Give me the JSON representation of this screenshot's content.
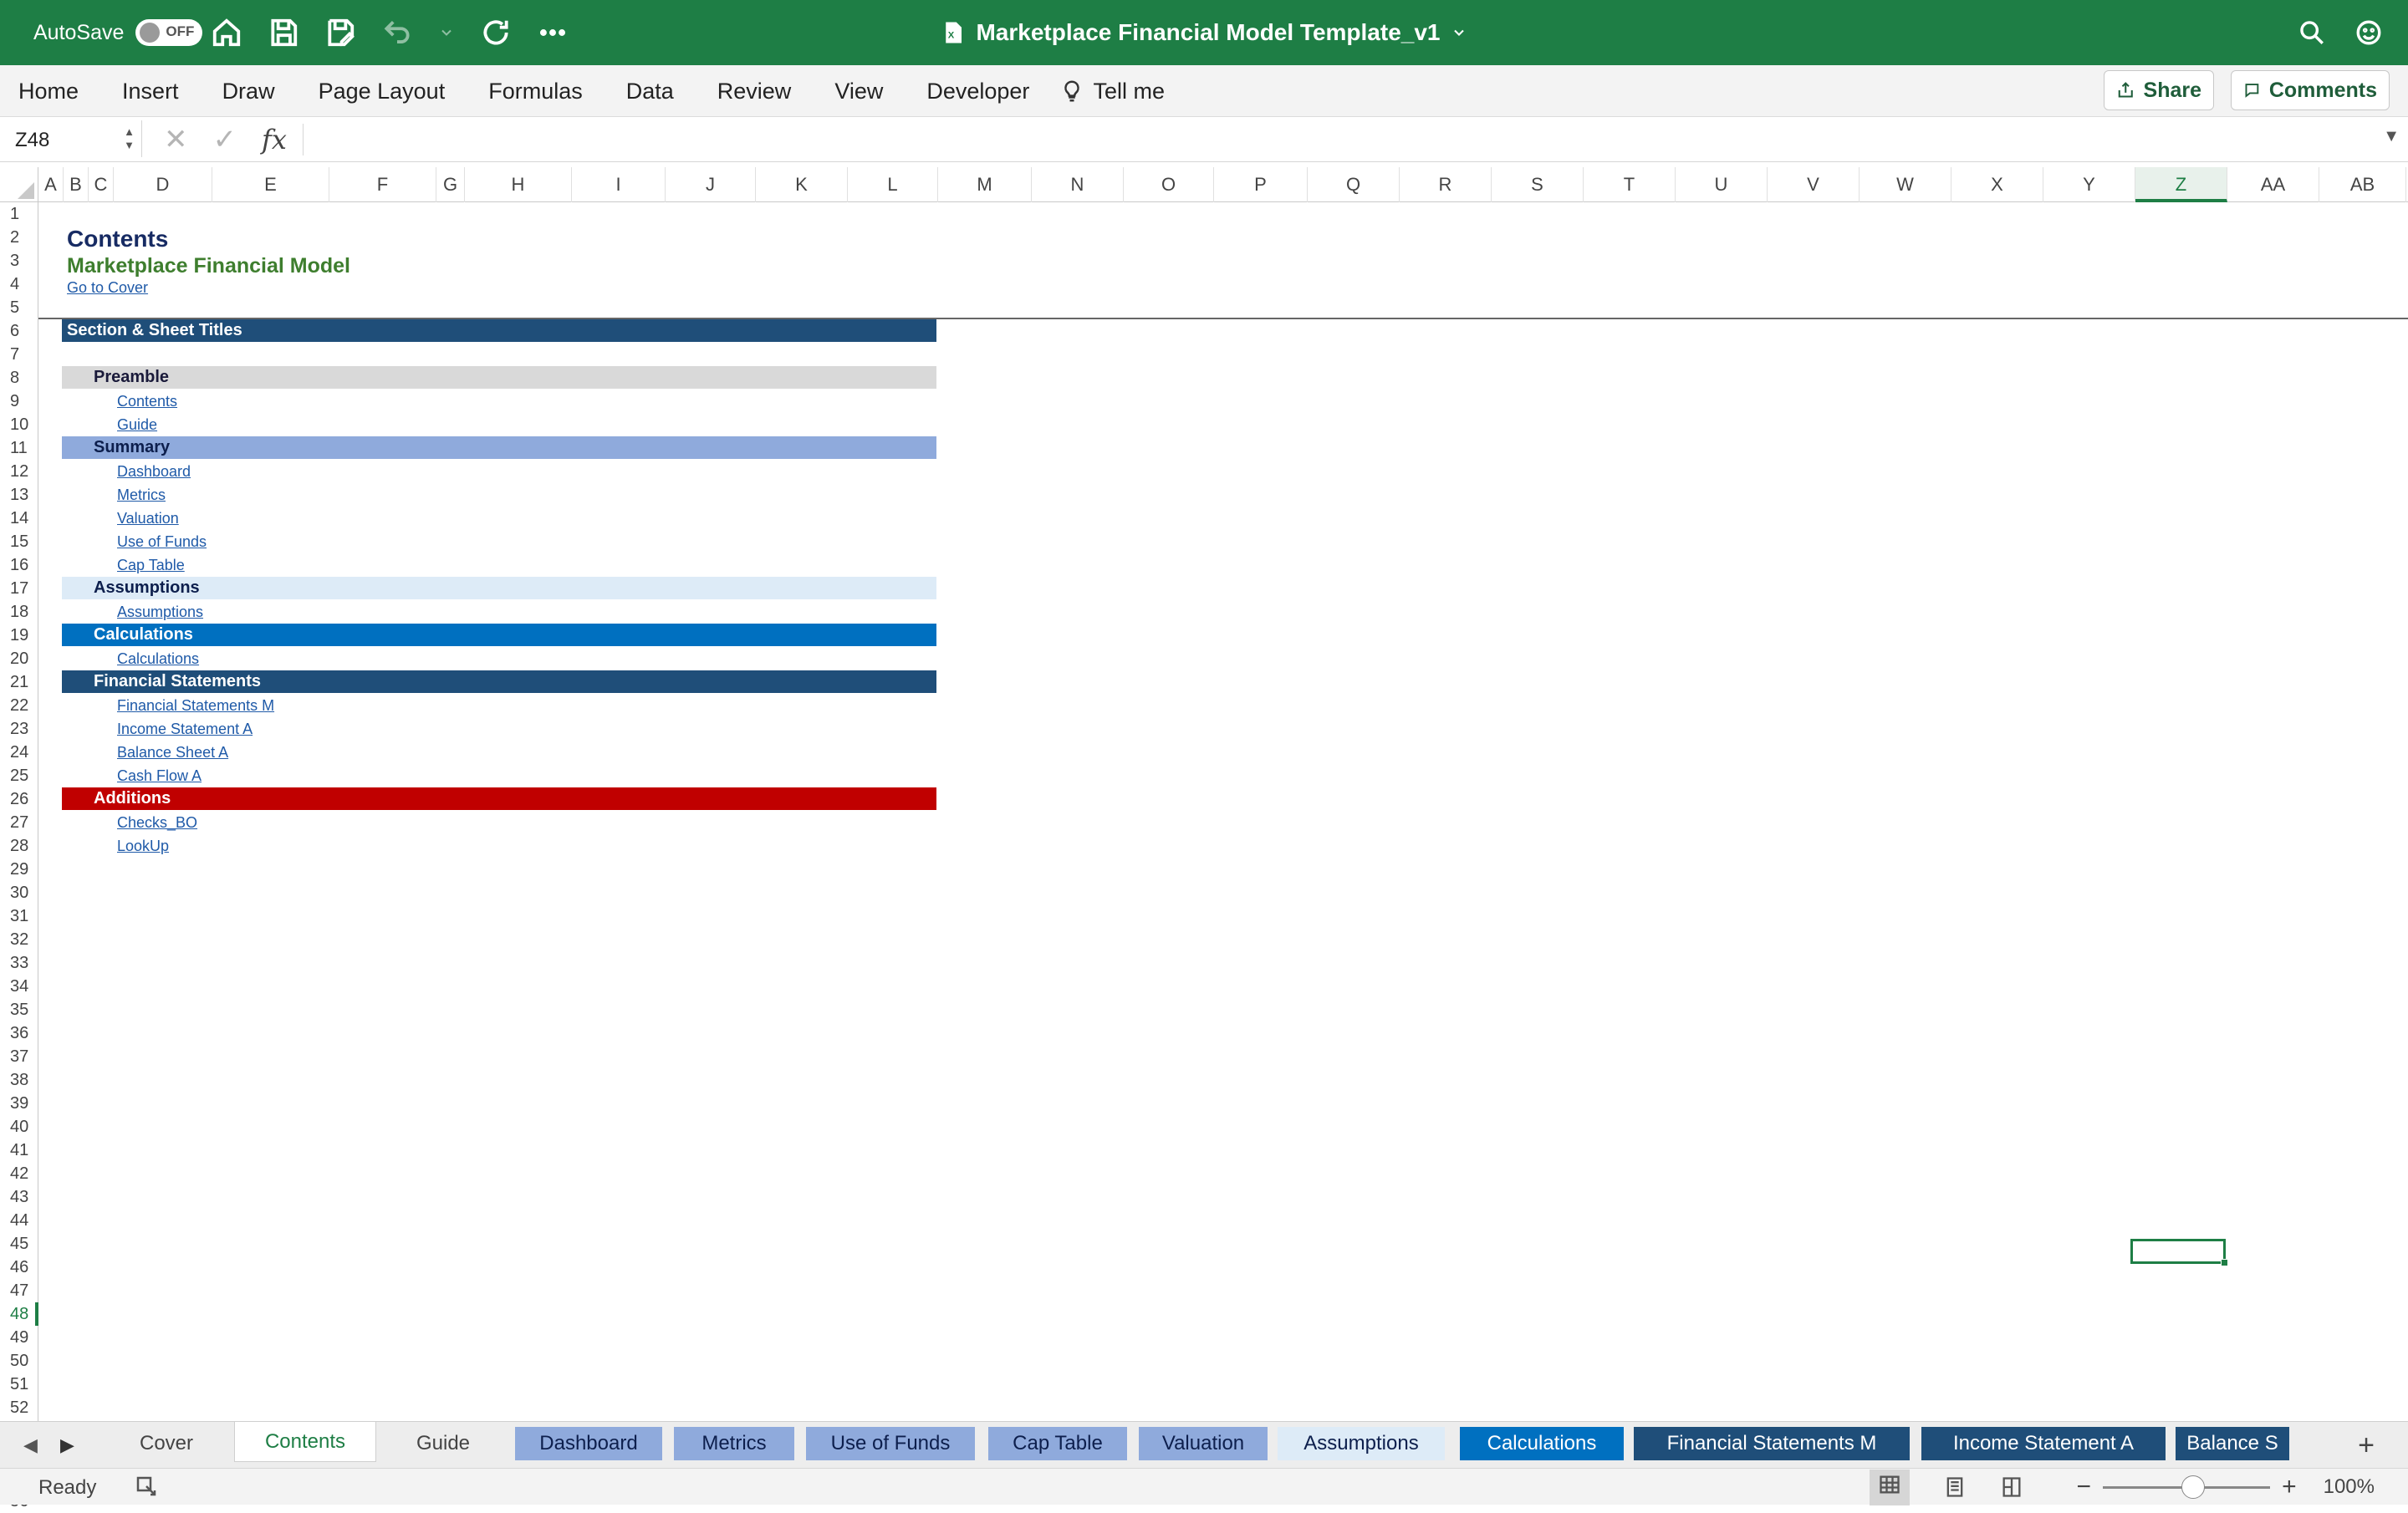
{
  "titlebar": {
    "autosave_label": "AutoSave",
    "autosave_state": "OFF",
    "doc_title": "Marketplace Financial Model Template_v1",
    "icons": [
      "home-icon",
      "save-icon",
      "save-as-icon",
      "undo-icon",
      "redo-icon",
      "more-icon"
    ],
    "right_icons": [
      "search-icon",
      "smiley-icon"
    ]
  },
  "ribbon": {
    "menu": [
      "Home",
      "Insert",
      "Draw",
      "Page Layout",
      "Formulas",
      "Data",
      "Review",
      "View",
      "Developer"
    ],
    "tell_me": "Tell me",
    "share_label": "Share",
    "comments_label": "Comments"
  },
  "formulabar": {
    "name_box": "Z48",
    "fx": "fx",
    "value": ""
  },
  "grid": {
    "columns": [
      "A",
      "B",
      "C",
      "D",
      "E",
      "F",
      "G",
      "H",
      "I",
      "J",
      "K",
      "L",
      "M",
      "N",
      "O",
      "P",
      "Q",
      "R",
      "S",
      "T",
      "U",
      "V",
      "W",
      "X",
      "Y",
      "Z",
      "AA",
      "AB"
    ],
    "selected_column": "Z",
    "selected_row": "48",
    "rows_count": 56,
    "heading": "Contents",
    "subheading": "Marketplace Financial Model",
    "go_to_cover": "Go to Cover",
    "table_header": "Section & Sheet Titles",
    "sections": [
      {
        "title": "Preamble",
        "color": "#d9d9d9",
        "text": "#1a1a3a",
        "links": [
          "Contents",
          "Guide"
        ]
      },
      {
        "title": "Summary",
        "color": "#8faadc",
        "text": "#0d1f4d",
        "links": [
          "Dashboard",
          "Metrics",
          "Valuation",
          "Use of Funds",
          "Cap Table"
        ]
      },
      {
        "title": "Assumptions",
        "color": "#ddebf7",
        "text": "#0d1f4d",
        "links": [
          "Assumptions"
        ]
      },
      {
        "title": "Calculations",
        "color": "#0070c0",
        "text": "#ffffff",
        "links": [
          "Calculations"
        ]
      },
      {
        "title": "Financial Statements",
        "color": "#1f4e79",
        "text": "#ffffff",
        "links": [
          "Financial Statements M",
          "Income Statement A",
          "Balance Sheet A",
          "Cash Flow A"
        ]
      },
      {
        "title": "Additions",
        "color": "#c00000",
        "text": "#ffffff",
        "links": [
          "Checks_BO",
          "LookUp"
        ]
      }
    ]
  },
  "sheet_tabs": [
    {
      "label": "Cover",
      "style": "plain"
    },
    {
      "label": "Contents",
      "style": "active"
    },
    {
      "label": "Guide",
      "style": "plain"
    },
    {
      "label": "Dashboard",
      "style": "summary"
    },
    {
      "label": "Metrics",
      "style": "summary"
    },
    {
      "label": "Use of Funds",
      "style": "summary"
    },
    {
      "label": "Cap Table",
      "style": "summary"
    },
    {
      "label": "Valuation",
      "style": "summary"
    },
    {
      "label": "Assumptions",
      "style": "assump"
    },
    {
      "label": "Calculations",
      "style": "calc"
    },
    {
      "label": "Financial Statements M",
      "style": "fs"
    },
    {
      "label": "Income Statement A",
      "style": "fs"
    },
    {
      "label": "Balance S",
      "style": "fs"
    }
  ],
  "statusbar": {
    "ready": "Ready",
    "zoom": "100%"
  },
  "colors": {
    "title_green": "#1e7e45",
    "tab_summary": "#8faadc",
    "tab_assump": "#ddebf7",
    "tab_calc": "#0070c0",
    "tab_fs": "#1f4e79"
  }
}
